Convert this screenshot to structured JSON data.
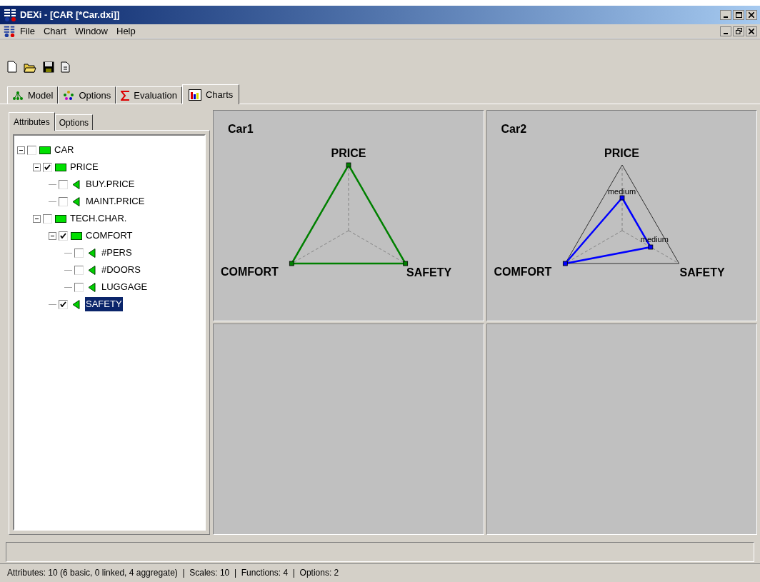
{
  "window": {
    "title": "DEXi - [CAR [*Car.dxi]]"
  },
  "menu": [
    "File",
    "Chart",
    "Window",
    "Help"
  ],
  "tabs": [
    {
      "label": "Model",
      "selected": false
    },
    {
      "label": "Options",
      "selected": false
    },
    {
      "label": "Evaluation",
      "selected": false
    },
    {
      "label": "Charts",
      "selected": true
    }
  ],
  "side_tabs": [
    {
      "label": "Attributes",
      "selected": true
    },
    {
      "label": "Options",
      "selected": false
    }
  ],
  "tree": [
    {
      "label": "CAR",
      "kind": "aggregate",
      "checked": false,
      "selected": false,
      "expanded": true,
      "children": [
        {
          "label": "PRICE",
          "kind": "aggregate",
          "checked": true,
          "selected": false,
          "expanded": true,
          "children": [
            {
              "label": "BUY.PRICE",
              "kind": "basic",
              "checked": false,
              "selected": false
            },
            {
              "label": "MAINT.PRICE",
              "kind": "basic",
              "checked": false,
              "selected": false
            }
          ]
        },
        {
          "label": "TECH.CHAR.",
          "kind": "aggregate",
          "checked": false,
          "selected": false,
          "expanded": true,
          "children": [
            {
              "label": "COMFORT",
              "kind": "aggregate",
              "checked": true,
              "selected": false,
              "expanded": true,
              "children": [
                {
                  "label": "#PERS",
                  "kind": "basic",
                  "checked": false,
                  "selected": false
                },
                {
                  "label": "#DOORS",
                  "kind": "basic",
                  "checked": false,
                  "selected": false
                },
                {
                  "label": "LUGGAGE",
                  "kind": "basic",
                  "checked": false,
                  "selected": false
                }
              ]
            },
            {
              "label": "SAFETY",
              "kind": "basic",
              "checked": true,
              "selected": true
            }
          ]
        }
      ]
    }
  ],
  "charts": [
    {
      "title": "Car1",
      "color": "#008000",
      "axes": [
        {
          "label": "PRICE"
        },
        {
          "label": "COMFORT"
        },
        {
          "label": "SAFETY"
        }
      ]
    },
    {
      "title": "Car2",
      "color": "#0000ff",
      "axes": [
        {
          "label": "PRICE",
          "value_label": "medium"
        },
        {
          "label": "COMFORT"
        },
        {
          "label": "SAFETY",
          "value_label": "medium"
        }
      ]
    }
  ],
  "status_bar": "Attributes: 10 (6 basic, 0 linked, 4 aggregate)  |  Scales: 10  |  Functions: 4  |  Options: 2"
}
